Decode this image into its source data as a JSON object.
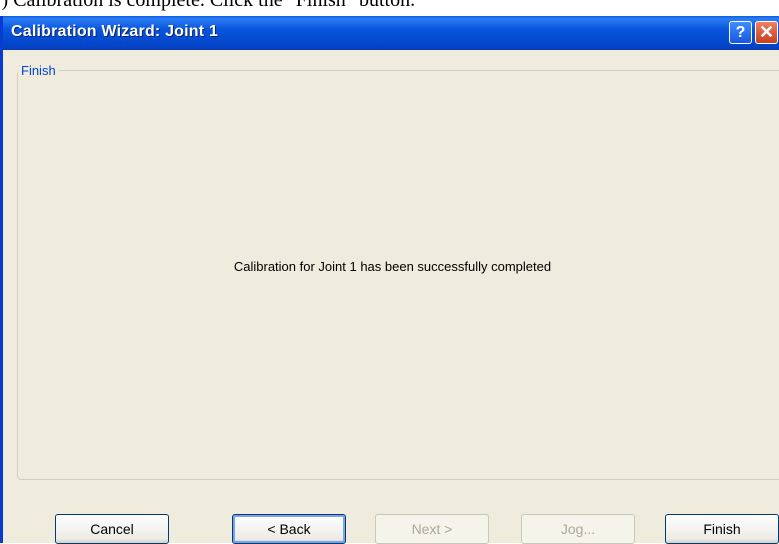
{
  "caption": "j) Calibration is complete.   Click the \"Finish\" button.",
  "window": {
    "title": "Calibration Wizard: Joint 1",
    "help_symbol": "?",
    "close_symbol": "✕"
  },
  "group": {
    "label": "Finish"
  },
  "message": "Calibration for Joint 1 has been successfully completed",
  "buttons": [
    {
      "label": "Cancel",
      "enabled": true
    },
    {
      "label": "< Back",
      "enabled": true
    },
    {
      "label": "Next >",
      "enabled": false
    },
    {
      "label": "Jog...",
      "enabled": false
    },
    {
      "label": "Finish",
      "enabled": true
    }
  ],
  "colors": {
    "titlebar": "#0855dd",
    "group_label": "#0046d5",
    "client": "#efebdd"
  }
}
